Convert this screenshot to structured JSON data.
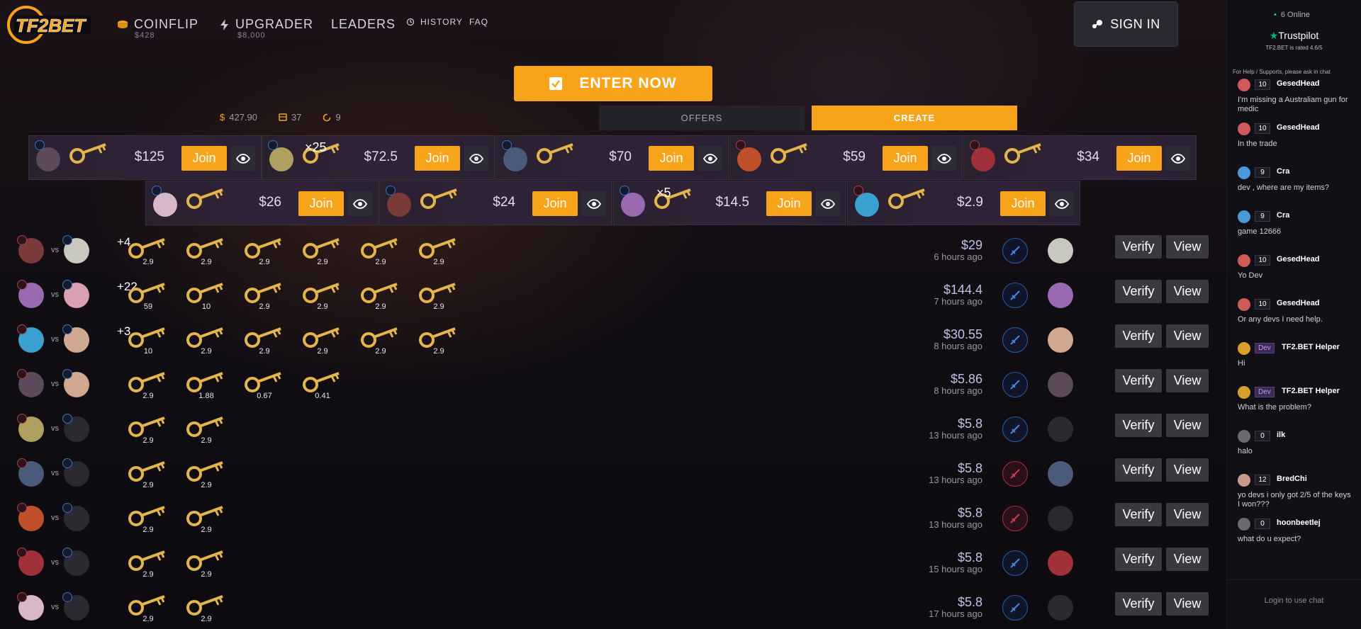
{
  "brand": {
    "logo": "TF2BET"
  },
  "nav": [
    {
      "label": "COINFLIP",
      "sub": "$428",
      "icon": "coin-icon"
    },
    {
      "label": "UPGRADER",
      "sub": "$8,000",
      "icon": "bolt-icon"
    },
    {
      "label": "LEADERS"
    },
    {
      "label": "HISTORY",
      "icon": "history-icon"
    },
    {
      "label": "FAQ"
    }
  ],
  "signin": "SIGN IN",
  "enter": "ENTER NOW",
  "stats": {
    "total": "427.90",
    "items": "37",
    "games": "9"
  },
  "tabs": {
    "offers": "OFFERS",
    "create": "CREATE"
  },
  "join_label": "Join",
  "open_games": [
    {
      "price": "$125",
      "mult": "",
      "flag": "blue"
    },
    {
      "price": "$72.5",
      "mult": "×25",
      "flag": "blue"
    },
    {
      "price": "$70",
      "mult": "",
      "flag": "blue"
    },
    {
      "price": "$59",
      "mult": "",
      "flag": "red"
    },
    {
      "price": "$34",
      "mult": "",
      "flag": "red"
    },
    {
      "price": "$26",
      "mult": "",
      "flag": "blue"
    },
    {
      "price": "$24",
      "mult": "",
      "flag": "blue"
    },
    {
      "price": "$14.5",
      "mult": "×5",
      "flag": "blue"
    },
    {
      "price": "$2.9",
      "mult": "",
      "flag": "red"
    }
  ],
  "history": {
    "vs": "vs",
    "verify": "Verify",
    "view": "View",
    "rows": [
      {
        "more": "+4",
        "items": [
          "2.9",
          "2.9",
          "2.9",
          "2.9",
          "2.9",
          "2.9"
        ],
        "amount": "$29",
        "ago": "6 hours ago",
        "side": "blue"
      },
      {
        "more": "+22",
        "items": [
          "59",
          "10",
          "2.9",
          "2.9",
          "2.9",
          "2.9"
        ],
        "amount": "$144.4",
        "ago": "7 hours ago",
        "side": "blue"
      },
      {
        "more": "+3",
        "items": [
          "10",
          "2.9",
          "2.9",
          "2.9",
          "2.9",
          "2.9"
        ],
        "amount": "$30.55",
        "ago": "8 hours ago",
        "side": "blue"
      },
      {
        "more": "",
        "items": [
          "2.9",
          "1.88",
          "0.67",
          "0.41"
        ],
        "amount": "$5.86",
        "ago": "8 hours ago",
        "side": "blue"
      },
      {
        "more": "",
        "items": [
          "2.9",
          "2.9"
        ],
        "amount": "$5.8",
        "ago": "13 hours ago",
        "side": "blue"
      },
      {
        "more": "",
        "items": [
          "2.9",
          "2.9"
        ],
        "amount": "$5.8",
        "ago": "13 hours ago",
        "side": "red"
      },
      {
        "more": "",
        "items": [
          "2.9",
          "2.9"
        ],
        "amount": "$5.8",
        "ago": "13 hours ago",
        "side": "red"
      },
      {
        "more": "",
        "items": [
          "2.9",
          "2.9"
        ],
        "amount": "$5.8",
        "ago": "15 hours ago",
        "side": "blue"
      },
      {
        "more": "",
        "items": [
          "2.9",
          "2.9"
        ],
        "amount": "$5.8",
        "ago": "17 hours ago",
        "side": "blue"
      }
    ]
  },
  "chat": {
    "online": "6 Online",
    "trustpilot": "Trustpilot",
    "rating": "TF2.BET is rated 4.6/5",
    "help": "For Help / Supports, please ask in chat",
    "login": "Login to use chat",
    "messages": [
      {
        "lvl": "10",
        "name": "GesedHead",
        "text": "I'm missing a Australiam gun for medic"
      },
      {
        "lvl": "10",
        "name": "GesedHead",
        "text": "In the trade"
      },
      {
        "lvl": "9",
        "name": "Cra",
        "text": "dev , where are my items?"
      },
      {
        "lvl": "9",
        "name": "Cra",
        "text": "game 12666"
      },
      {
        "lvl": "10",
        "name": "GesedHead",
        "text": "Yo Dev"
      },
      {
        "lvl": "10",
        "name": "GesedHead",
        "text": "Or any devs I need help."
      },
      {
        "lvl": "Dev",
        "name": "TF2.BET Helper",
        "text": "Hi"
      },
      {
        "lvl": "Dev",
        "name": "TF2.BET Helper",
        "text": "What is the problem?"
      },
      {
        "lvl": "0",
        "name": "ilk",
        "text": "halo"
      },
      {
        "lvl": "12",
        "name": "BredChi",
        "text": "yo devs i only got 2/5 of the keys I won???"
      },
      {
        "lvl": "0",
        "name": "hoonbeetlej",
        "text": "what do u expect?"
      }
    ]
  }
}
